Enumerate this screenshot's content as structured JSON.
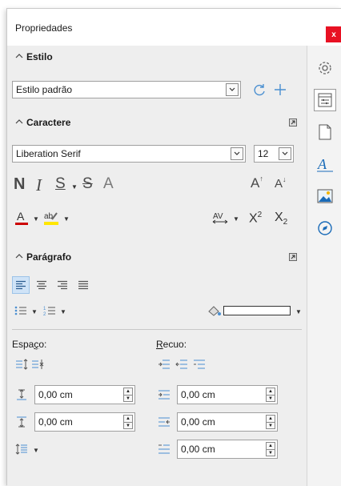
{
  "window": {
    "title": "Propriedades",
    "close_label": "x"
  },
  "colors": {
    "accent": "#1a6bb8",
    "font_color": "#cc0000",
    "highlight": "#ffe600",
    "close": "#e81123"
  },
  "panels": {
    "estilo": {
      "title": "Estilo",
      "style_value": "Estilo padrão"
    },
    "caractere": {
      "title": "Caractere",
      "font_name": "Liberation Serif",
      "font_size": "12",
      "bold": "N",
      "italic": "I",
      "underline": "S",
      "strike": "S",
      "shadow": "A",
      "grow": "A",
      "shrink": "A",
      "spacing": "AV",
      "superscript": "X",
      "superscript_exp": "2",
      "subscript": "X",
      "subscript_exp": "2"
    },
    "paragrafo": {
      "title": "Parágrafo",
      "spacing_label_pre": "Espa",
      "spacing_label_acc": "ç",
      "spacing_label_post": "o:",
      "indent_label_acc": "R",
      "indent_label_post": "ecuo:",
      "above_spacing": "0,00 cm",
      "below_spacing": "0,00 cm",
      "before_indent": "0,00 cm",
      "after_indent": "0,00 cm",
      "first_line_indent": "0,00 cm"
    }
  },
  "tabs": [
    {
      "name": "properties-tab",
      "icon": "gear-icon"
    },
    {
      "name": "properties-deck-tab",
      "icon": "sliders-icon"
    },
    {
      "name": "page-tab",
      "icon": "page-icon"
    },
    {
      "name": "styles-tab",
      "icon": "styles-icon"
    },
    {
      "name": "gallery-tab",
      "icon": "gallery-icon"
    },
    {
      "name": "navigator-tab",
      "icon": "navigator-icon"
    }
  ]
}
